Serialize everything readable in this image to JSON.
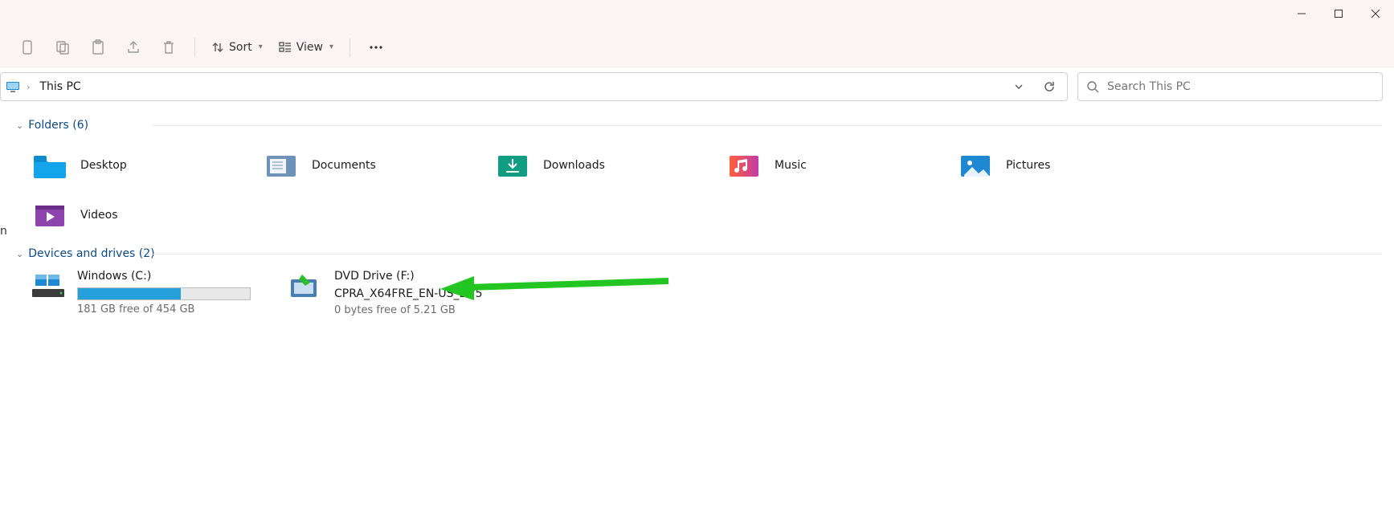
{
  "window": {
    "minimize_tooltip": "Minimize",
    "maximize_tooltip": "Maximize",
    "close_tooltip": "Close"
  },
  "toolbar": {
    "sort_label": "Sort",
    "view_label": "View"
  },
  "address": {
    "current_location": "This PC"
  },
  "search": {
    "placeholder": "Search This PC"
  },
  "groups": {
    "folders": {
      "header": "Folders (6)",
      "items": [
        {
          "label": "Desktop"
        },
        {
          "label": "Documents"
        },
        {
          "label": "Downloads"
        },
        {
          "label": "Music"
        },
        {
          "label": "Pictures"
        },
        {
          "label": "Videos"
        }
      ]
    },
    "drives": {
      "header": "Devices and drives (2)",
      "items": [
        {
          "name": "Windows (C:)",
          "free_text": "181 GB free of 454 GB",
          "fill_percent": 60
        },
        {
          "name_line1": "DVD Drive (F:)",
          "name_line2": "CPRA_X64FRE_EN-US_DV5",
          "free_text": "0 bytes free of 5.21 GB"
        }
      ]
    }
  }
}
